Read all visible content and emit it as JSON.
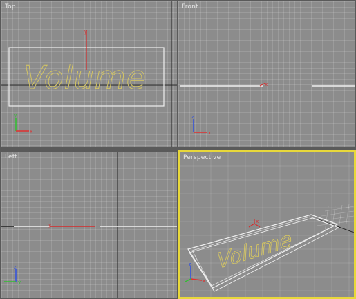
{
  "viewports": {
    "top": {
      "label": "Top"
    },
    "front": {
      "label": "Front"
    },
    "left": {
      "label": "Left"
    },
    "perspective": {
      "label": "Perspective"
    }
  },
  "scene_text": "Volume",
  "axes": {
    "x": "x",
    "y": "y",
    "z": "z"
  },
  "colors": {
    "viewport_bg": "#8c8c8c",
    "active_border": "#e8d83a",
    "text_outline": "#d8c860",
    "gizmo_red": "#d62b2b",
    "axis_x": "#e03030",
    "axis_y": "#30c030",
    "axis_z": "#3050e0",
    "box_white": "#f0f0f0"
  }
}
